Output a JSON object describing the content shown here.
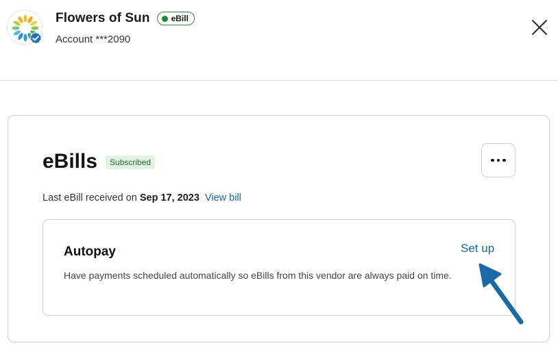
{
  "header": {
    "vendor_name": "Flowers of Sun",
    "ebill_label": "eBill",
    "account_label": "Account ***2090"
  },
  "ebills_card": {
    "title": "eBills",
    "status_badge": "Subscribed",
    "last_received_prefix": "Last eBill received on",
    "last_received_date": "Sep 17, 2023",
    "view_bill_link": "View bill",
    "autopay": {
      "title": "Autopay",
      "description": "Have payments scheduled automatically so eBills from this vendor are always paid on time.",
      "setup_link": "Set up"
    }
  },
  "icons": {
    "logo": "flower-logo-icon",
    "verified": "verified-check-icon",
    "close": "close-icon",
    "more": "more-dots-icon",
    "annotation": "arrow-annotation"
  },
  "colors": {
    "link": "#1066b5",
    "ebill_green": "#2e8b3a",
    "subscribed_bg": "#e3f3e3",
    "arrow_blue": "#1a6aa8"
  }
}
